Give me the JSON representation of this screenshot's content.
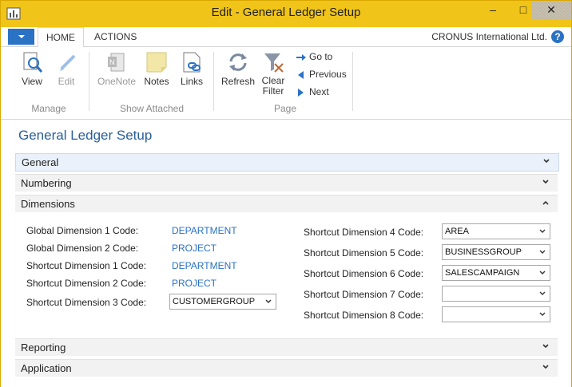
{
  "window": {
    "title": "Edit - General Ledger Setup",
    "minimize": "–",
    "maximize": "□",
    "close": "✕"
  },
  "tabs": {
    "home": "HOME",
    "actions": "ACTIONS"
  },
  "company": "CRONUS International Ltd.",
  "help": "?",
  "ribbon": {
    "manage": {
      "view": "View",
      "edit": "Edit",
      "label": "Manage"
    },
    "attached": {
      "onenote": "OneNote",
      "notes": "Notes",
      "links": "Links",
      "label": "Show Attached"
    },
    "page": {
      "refresh": "Refresh",
      "clear_filter_1": "Clear",
      "clear_filter_2": "Filter",
      "goto": "Go to",
      "previous": "Previous",
      "next": "Next",
      "label": "Page"
    }
  },
  "page_title": "General Ledger Setup",
  "fasttabs": {
    "general": "General",
    "numbering": "Numbering",
    "dimensions": "Dimensions",
    "reporting": "Reporting",
    "application": "Application"
  },
  "dimensions": {
    "left": [
      {
        "label": "Global Dimension 1 Code:",
        "value": "DEPARTMENT"
      },
      {
        "label": "Global Dimension 2 Code:",
        "value": "PROJECT"
      },
      {
        "label": "Shortcut Dimension 1 Code:",
        "value": "DEPARTMENT"
      },
      {
        "label": "Shortcut Dimension 2 Code:",
        "value": "PROJECT"
      },
      {
        "label": "Shortcut Dimension 3 Code:",
        "value": "CUSTOMERGROUP"
      }
    ],
    "right": [
      {
        "label": "Shortcut Dimension 4 Code:",
        "value": "AREA"
      },
      {
        "label": "Shortcut Dimension 5 Code:",
        "value": "BUSINESSGROUP"
      },
      {
        "label": "Shortcut Dimension 6 Code:",
        "value": "SALESCAMPAIGN"
      },
      {
        "label": "Shortcut Dimension 7 Code:",
        "value": ""
      },
      {
        "label": "Shortcut Dimension 8 Code:",
        "value": ""
      }
    ]
  },
  "colors": {
    "titlebar": "#f0c419",
    "accent": "#2a72c4",
    "link": "#2a72c4"
  }
}
